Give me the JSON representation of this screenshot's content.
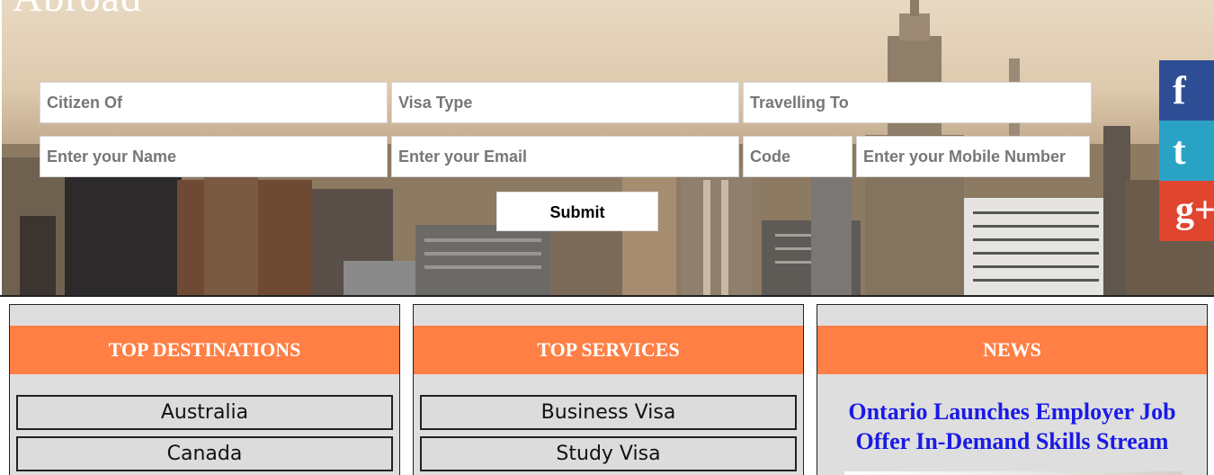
{
  "hero": {
    "title": "Abroad",
    "form": {
      "citizen_of": "Citizen Of",
      "visa_type": "Visa Type",
      "travelling_to": "Travelling To",
      "name_placeholder": "Enter your Name",
      "email_placeholder": "Enter your Email",
      "code_placeholder": "Code",
      "mobile_placeholder": "Enter your Mobile Number",
      "submit_label": "Submit"
    }
  },
  "social": {
    "facebook": "f",
    "twitter": "t",
    "googleplus": "g+"
  },
  "panels": {
    "destinations": {
      "title": "TOP DESTINATIONS",
      "items": [
        "Australia",
        "Canada"
      ]
    },
    "services": {
      "title": "TOP SERVICES",
      "items": [
        "Business Visa",
        "Study Visa"
      ]
    },
    "news": {
      "title": "NEWS",
      "headline": "Ontario Launches Employer Job Offer In-Demand Skills Stream"
    }
  },
  "colors": {
    "panel_header": "#ff7f45",
    "facebook": "#2d4e95",
    "twitter": "#2aa2c6",
    "googleplus": "#e0452f",
    "news_link": "#1a1ae6"
  },
  "icons": {
    "facebook": "facebook-icon",
    "twitter": "twitter-icon",
    "googleplus": "googleplus-icon"
  }
}
